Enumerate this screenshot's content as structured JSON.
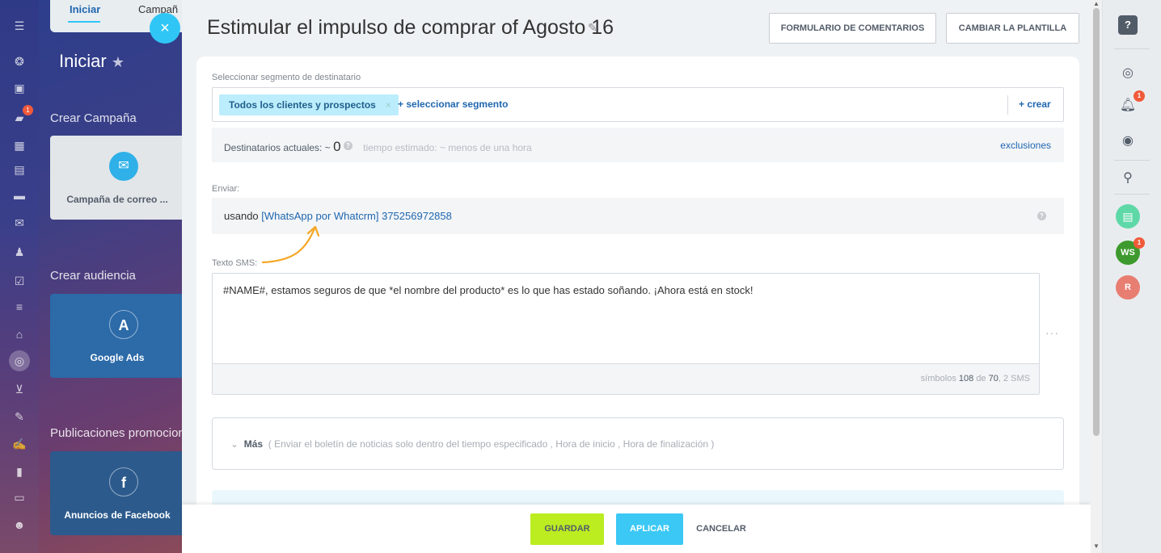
{
  "background": {
    "tabs": [
      "Iniciar",
      "Campañ"
    ],
    "title": "Iniciar",
    "sections": [
      "Crear Campaña",
      "Crear audiencia",
      "Publicaciones promocion"
    ],
    "cards": [
      "Campaña de correo ...",
      "Google Ads",
      "Anuncios de Facebook"
    ]
  },
  "rail_icons": [
    "menu-icon",
    "sites-icon",
    "tasks-icon",
    "chat-icon",
    "calendar-icon",
    "docs-icon",
    "crm-icon",
    "mail-icon",
    "contacts-icon",
    "checklist-icon",
    "filter-icon",
    "store-icon",
    "marketing-icon",
    "cart-icon",
    "sign-icon",
    "edit-icon",
    "analytics-icon",
    "card-icon",
    "robot-icon"
  ],
  "rail_badge": "1",
  "header": {
    "title": "Estimular el impulso de comprar of Agosto 16",
    "feedback_button": "FORMULARIO DE COMENTARIOS",
    "template_button": "CAMBIAR LA PLANTILLA"
  },
  "segment": {
    "label": "Seleccionar segmento de destinatario",
    "chip": "Todos los clientes y prospectos",
    "chip_remove": "×",
    "select_link": "+ seleccionar segmento",
    "create_link": "+ crear"
  },
  "recipients": {
    "label": "Destinatarios actuales: ~",
    "count": "0",
    "estimate": "tiempo estimado: ~ menos de una hora",
    "exclusions": "exclusiones"
  },
  "send": {
    "label": "Enviar:",
    "using": "usando",
    "channel": "[WhatsApp por Whatcrm] 375256972858"
  },
  "sms": {
    "label": "Texto SMS:",
    "text": "#NAME#, estamos seguros de que *el nombre del producto* es lo que has estado soñando. ¡Ahora está en stock!",
    "counter_prefix": "símbolos",
    "counter_count": "108",
    "counter_mid": "de",
    "counter_max": "70",
    "counter_sms": ", 2 SMS"
  },
  "more": {
    "label": "Más",
    "details": "( Enviar el boletín de noticias solo dentro del tiempo especificado ,  Hora de inicio ,  Hora de finalización  )"
  },
  "footer": {
    "save": "GUARDAR",
    "apply": "APLICAR",
    "cancel": "CANCELAR"
  },
  "right_rail": {
    "notification_badge": "1",
    "ws_badge": "1",
    "ws_avatar": "WS",
    "user_avatar": "R"
  },
  "colors": {
    "accent": "#2fc6f6",
    "save": "#bbed21",
    "link": "#2067b0",
    "arrow": "#f5a623"
  }
}
